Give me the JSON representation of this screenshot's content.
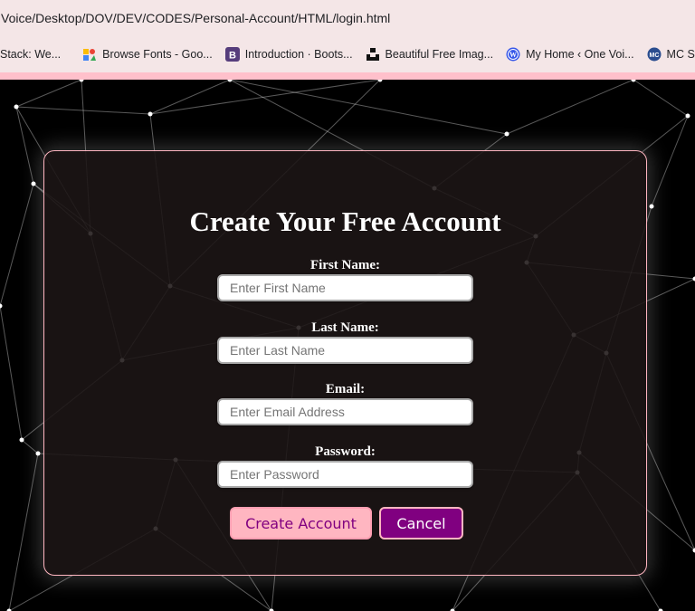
{
  "browser": {
    "url": "Voice/Desktop/DOV/DEV/CODES/Personal-Account/HTML/login.html",
    "bookmarks": [
      {
        "label": "Stack: We...",
        "icon": "none"
      },
      {
        "label": "Browse Fonts - Goo...",
        "icon": "google-fonts-icon"
      },
      {
        "label": "Introduction · Boots...",
        "icon": "bootstrap-icon"
      },
      {
        "label": "Beautiful Free Imag...",
        "icon": "unsplash-icon"
      },
      {
        "label": "My Home ‹ One Voi...",
        "icon": "wordpress-icon"
      },
      {
        "label": "MC Starte",
        "icon": "mc-icon"
      }
    ]
  },
  "form": {
    "title": "Create Your Free Account",
    "fields": [
      {
        "label": "First Name:",
        "placeholder": "Enter First Name"
      },
      {
        "label": "Last Name:",
        "placeholder": "Enter Last Name"
      },
      {
        "label": "Email:",
        "placeholder": "Enter Email Address"
      },
      {
        "label": "Password:",
        "placeholder": "Enter Password"
      }
    ],
    "create_label": "Create Account",
    "cancel_label": "Cancel"
  },
  "colors": {
    "accent_pink": "#ffb6c1",
    "accent_purple": "#800080",
    "browser_bg": "#f4e6e7"
  }
}
